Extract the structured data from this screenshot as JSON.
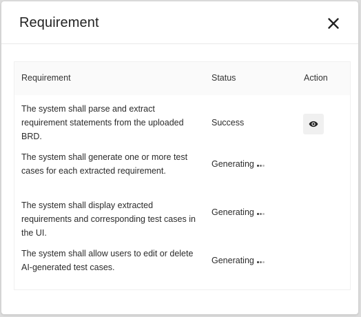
{
  "dialog": {
    "title": "Requirement",
    "close_icon": "close-icon"
  },
  "table": {
    "headers": {
      "requirement": "Requirement",
      "status": "Status",
      "action": "Action"
    },
    "rows": [
      {
        "requirement": "The system shall parse and extract requirement statements from the uploaded BRD.",
        "status": "Success",
        "action_icon": "eye-icon"
      },
      {
        "requirement": "The system shall generate one or more test cases for each extracted requirement.",
        "status": "Generating"
      },
      {
        "requirement": "The system shall display extracted requirements and corresponding test cases in the UI.",
        "status": "Generating"
      },
      {
        "requirement": "The system shall allow users to edit or delete AI-generated test cases.",
        "status": "Generating"
      }
    ]
  }
}
